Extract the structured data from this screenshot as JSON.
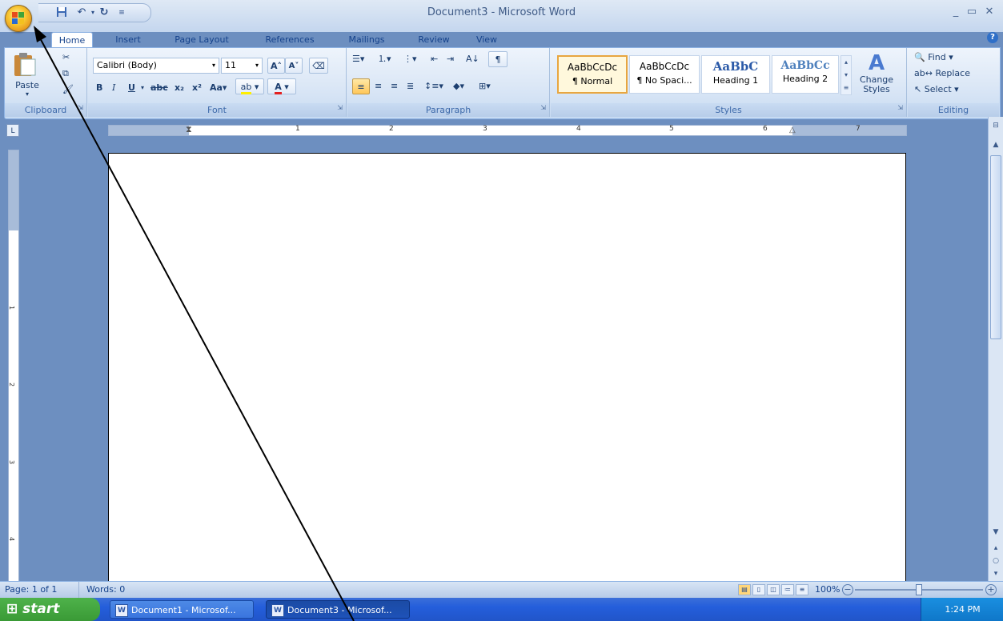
{
  "window": {
    "title": "Document3 - Microsoft Word"
  },
  "quick_access": {
    "icons": [
      "save-icon",
      "undo-icon",
      "redo-icon",
      "customize-icon"
    ]
  },
  "tabs": [
    "Home",
    "Insert",
    "Page Layout",
    "References",
    "Mailings",
    "Review",
    "View"
  ],
  "active_tab": "Home",
  "ribbon": {
    "clipboard": {
      "label": "Clipboard",
      "paste": "Paste"
    },
    "font": {
      "label": "Font",
      "font_name": "Calibri (Body)",
      "font_size": "11"
    },
    "paragraph": {
      "label": "Paragraph"
    },
    "styles": {
      "label": "Styles",
      "items": [
        {
          "sample": "AaBbCcDc",
          "name": "¶ Normal"
        },
        {
          "sample": "AaBbCcDc",
          "name": "¶ No Spaci..."
        },
        {
          "sample": "AaBbC",
          "name": "Heading 1"
        },
        {
          "sample": "AaBbCc",
          "name": "Heading 2"
        }
      ],
      "change_styles": "Change Styles"
    },
    "editing": {
      "label": "Editing",
      "find": "Find",
      "replace": "Replace",
      "select": "Select"
    }
  },
  "ruler": {
    "h_numbers": [
      "1",
      "2",
      "3",
      "4",
      "5",
      "6",
      "7"
    ],
    "v_numbers": [
      "1",
      "2",
      "3",
      "4"
    ],
    "corner": "L"
  },
  "statusbar": {
    "page": "Page: 1 of 1",
    "words": "Words: 0",
    "zoom": "100%"
  },
  "taskbar": {
    "start": "start",
    "tasks": [
      "Document1 - Microsof...",
      "Document3 - Microsof..."
    ],
    "clock": "1:24 PM"
  },
  "colors": {
    "ribbon_bg": "#dbe7f6",
    "office_button": "#f7c430",
    "taskbar": "#245edb",
    "start": "#3a9a36"
  }
}
